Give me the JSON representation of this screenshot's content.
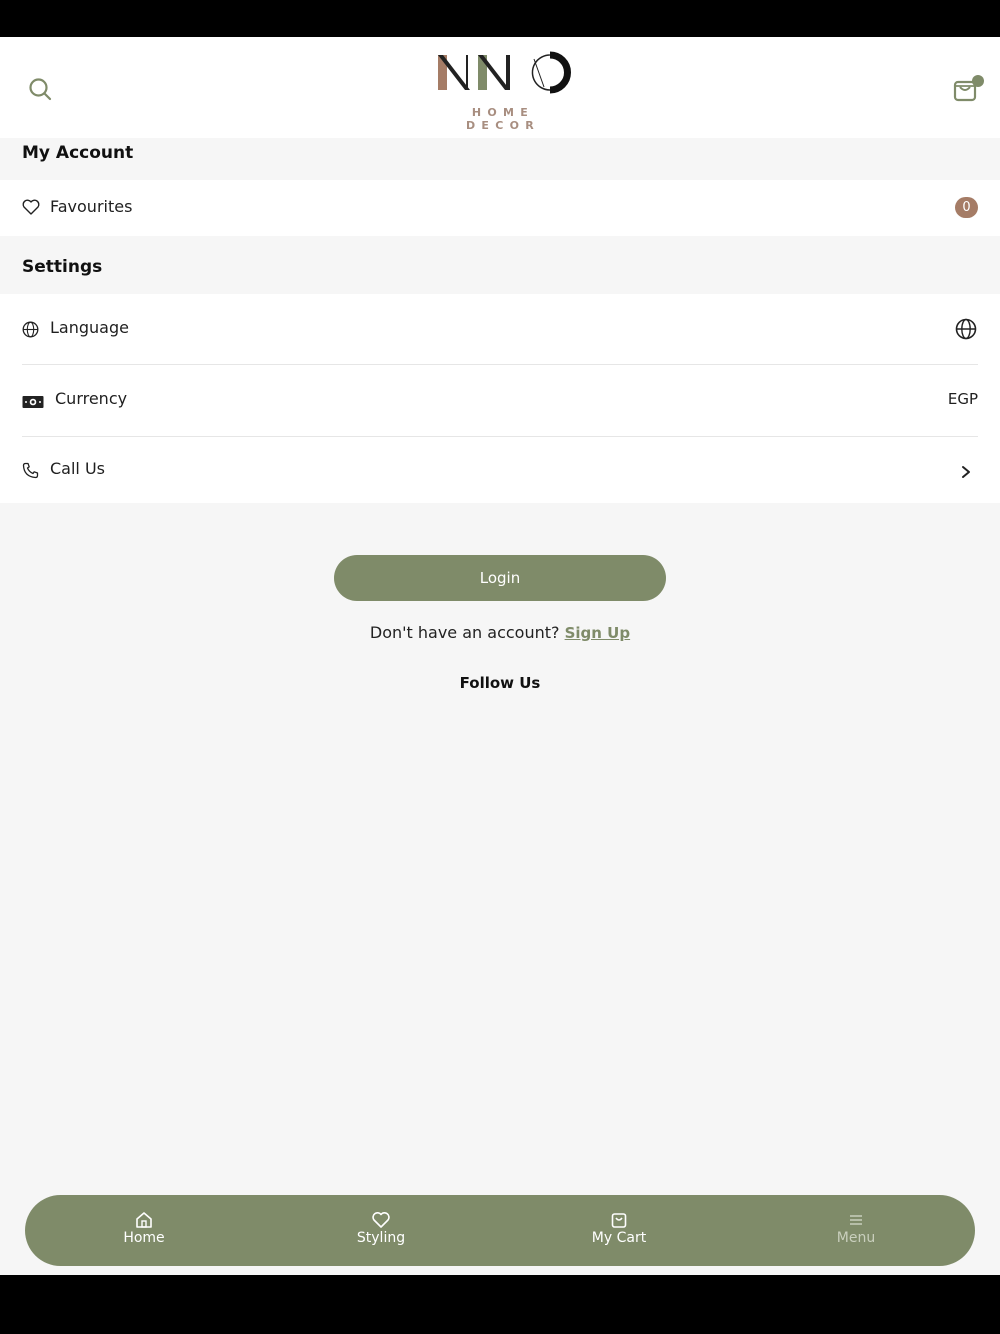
{
  "app": {
    "brand": "NNO",
    "brand_sub": "HOME DECOR"
  },
  "header": {
    "search_icon": "search-icon",
    "cart_icon": "shopping-bag-icon"
  },
  "my_account": {
    "title": "My Account",
    "favourites_label": "Favourites",
    "favourites_count": "0"
  },
  "settings": {
    "title": "Settings",
    "language_label": "Language",
    "currency_label": "Currency",
    "currency_value": "EGP",
    "call_us_label": "Call Us"
  },
  "auth": {
    "login_label": "Login",
    "no_account_text": "Don't have an account?",
    "signup_label": "Sign Up"
  },
  "follow_us": "Follow Us",
  "bottom_nav": {
    "home": "Home",
    "styling": "Styling",
    "cart": "My Cart",
    "menu": "Menu"
  },
  "colors": {
    "accent": "#7f8b69",
    "badge": "#a57c66",
    "background": "#f6f6f6"
  }
}
